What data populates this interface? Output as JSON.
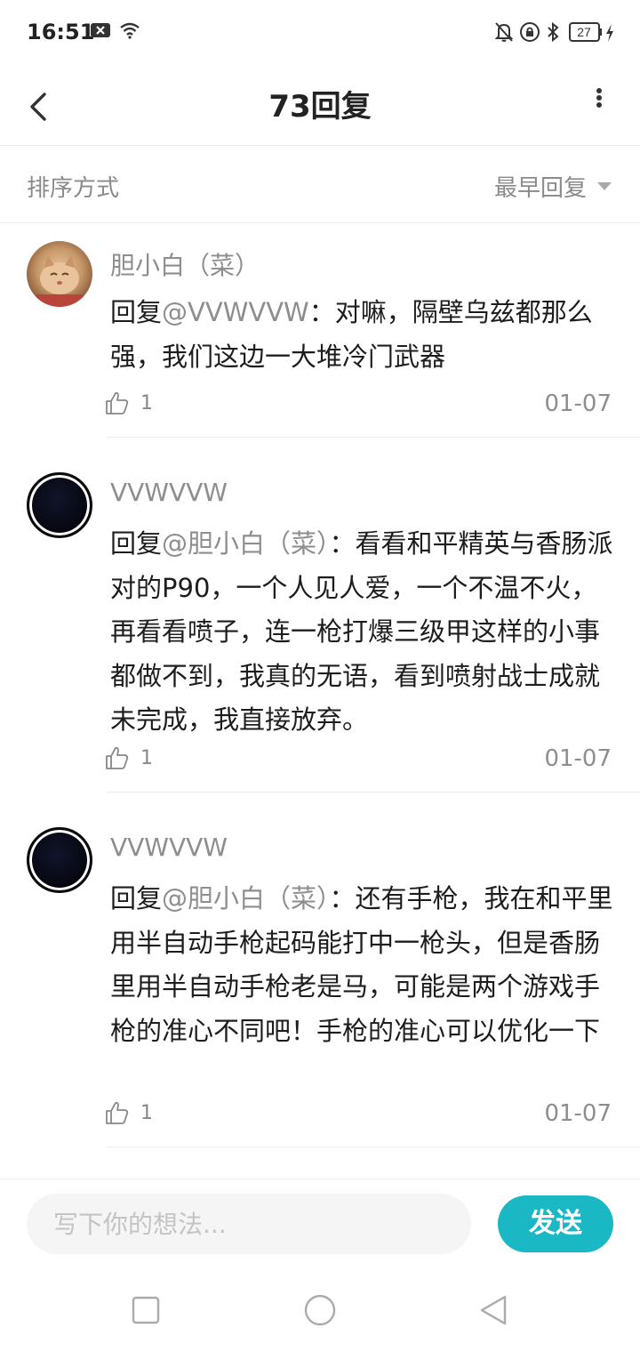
{
  "status_bar": {
    "time": "16:51",
    "battery": "27",
    "icons": [
      "close-box-icon",
      "wifi-icon",
      "bell-off-icon",
      "lock-rotation-icon",
      "bluetooth-icon",
      "battery-icon",
      "charging-icon"
    ]
  },
  "header": {
    "title": "73回复",
    "back_icon": "chevron-left-icon",
    "more_icon": "more-vertical-icon"
  },
  "sort": {
    "label": "排序方式",
    "value": "最早回复"
  },
  "replies": [
    {
      "username": "胆小白（菜）",
      "prefix": "回复",
      "mention": "@VVWVVW",
      "text": "：对嘛，隔壁乌兹都那么强，我们这边一大堆冷门武器",
      "likes": "1",
      "date": "01-07"
    },
    {
      "username": "VVWVVW",
      "prefix": "回复",
      "mention": "@胆小白（菜）",
      "text": "：看看和平精英与香肠派对的P90，一个人见人爱，一个不温不火，再看看喷子，连一枪打爆三级甲这样的小事都做不到，我真的无语，看到喷射战士成就未完成，我直接放弃。",
      "likes": "1",
      "date": "01-07"
    },
    {
      "username": "VVWVVW",
      "prefix": "回复",
      "mention": "@胆小白（菜）",
      "text": "：还有手枪，我在和平里用半自动手枪起码能打中一枪头，但是香肠里用半自动手枪老是马，可能是两个游戏手枪的准心不同吧！手枪的准心可以优化一下",
      "likes": "1",
      "date": "01-07"
    }
  ],
  "composer": {
    "placeholder": "写下你的想法...",
    "send_label": "发送",
    "accent": "#1ab7c4"
  },
  "nav": {
    "icons": [
      "recents-square-icon",
      "home-circle-icon",
      "back-triangle-icon"
    ]
  }
}
